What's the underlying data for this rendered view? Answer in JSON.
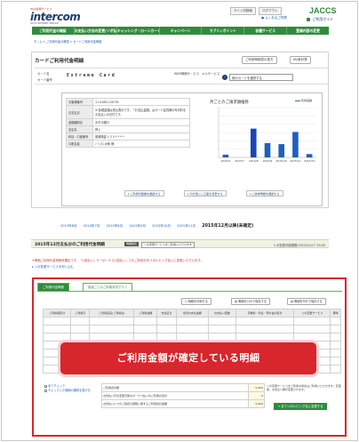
{
  "header": {
    "logo_sub": "Web会員サービス",
    "logo": "intercom",
    "logo_tag": "JACCS INTERNET SERVICE",
    "top_buttons": [
      "サイト内検索",
      "ログアウト"
    ],
    "faq_link": "よくあるご質問",
    "brand": "JACCS",
    "guide": "ご利用ガイド"
  },
  "nav": [
    "ご利用代金の確認",
    "お支払い方法の変更(リボ払い)",
    "キャッシング・ローンカード",
    "キャンペーン",
    "ラブリィポイント",
    "各種サービス",
    "登録内容の変更"
  ],
  "breadcrumb": "ホーム > ご利用代金の確認 > カードご利用代金明細",
  "panel": {
    "title": "カードご利用代金明細",
    "btn_print": "ご利用明細書の見方",
    "btn_mypage": "My家計簿",
    "card_label": "カード名",
    "card_no_label": "カード番号",
    "card_name": "Extreme Card",
    "service_labels": [
      "WEB明細サービス",
      "メルサービス"
    ],
    "select_label": "他のカードを選択する"
  },
  "info": {
    "rows": [
      {
        "k": "お客様番号",
        "v": "11-01651-04795"
      },
      {
        "k": "お支払日",
        "v": "※ 各種金額は税込表示です。「お支払金額」はカード会員様の年次料をお支払いの日付です。"
      },
      {
        "k": "金融機関名",
        "v": "みずほ銀行"
      },
      {
        "k": "支店名",
        "v": "押上"
      },
      {
        "k": "科目・口座番号",
        "v": "普通預金 1 3 5 * * * *"
      },
      {
        "k": "口座名義",
        "v": "ｼﾞｬｯｸｽ 太郎 様"
      }
    ]
  },
  "chart_data": {
    "type": "bar",
    "title": "月ごとのご請求額推移",
    "legend": "利用実績",
    "categories": [
      "2015/6",
      "2015/7",
      "2015/8",
      "2015/9",
      "2015/10",
      "2015/11",
      "2015/12"
    ],
    "values": [
      5000,
      0,
      52000,
      26000,
      24000,
      46000,
      6000
    ],
    "ylim": [
      0,
      90000
    ],
    "bar_color": "#1f5fbf",
    "highlight_index": 2,
    "highlight_color": "#1a46b8"
  },
  "actions": [
    "ご利用可能額を確認する",
    "引き落とし口座を変更する",
    "ご請求明細を確認する"
  ],
  "months": {
    "links": [
      "2015年6月",
      "2015年7月",
      "2015年8月",
      "2015年9月",
      "2015年10月",
      "2015年11月"
    ],
    "current": "2015年12月以降(未確定)"
  },
  "summary": {
    "title": "2015年12月支払分のご利用代金明細",
    "badge": "明細確定",
    "badge_note": "リボ変更サービスをご利用いただけます",
    "date": "リボ変更可能期間:2015/12/17 19:00"
  },
  "notes": {
    "red": "※明細ご利用代金明細未確定です。「1回払い」や「ボーナス1回払い」でのご利用分をリボルビング払いに変更いただけます。",
    "link": "▸ リボ変更サービスを申し込む"
  },
  "tabs": [
    "ご利用代金明細",
    "用途ごとのご利用状況グラフ"
  ],
  "tools": [
    "明細を印刷する",
    "明細をCSVで保存する",
    "明細をPDFで保存する"
  ],
  "grid_headers": [
    "ご利用者区分",
    "ご利用日",
    "ご利用店名(ご利用先)",
    "ご利用金額",
    "支払区分",
    "当月お支払金額",
    "お支払い回数",
    "手数料・利息・預け金の区分",
    "リボ変更サービス",
    "備考"
  ],
  "overlay": "ご利用金額が確定している明細",
  "foot": [
    "全てチェック",
    "チェックした明細の通知を投げる"
  ],
  "totals": [
    {
      "k": "ご利用合計額",
      "v": "5,000"
    },
    {
      "k": "お支払い日を変更可能なボーナス払いのご利用の合計",
      "v": "0"
    },
    {
      "k": "お支払いにつきご指定の回数に関するご利用合計金額",
      "v": "5,000"
    }
  ],
  "rev_note": "リボ変更サービスをご利用の場合はご利用いただきます。変更後、お支払い額が変更されます。",
  "rev_button": "→ 全てリボルビング払に変更する"
}
